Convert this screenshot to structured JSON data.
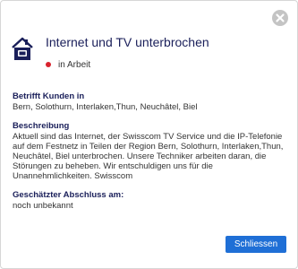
{
  "dialog": {
    "title": "Internet und TV unterbrochen",
    "status": {
      "text": "in Arbeit",
      "color": "#d9232e"
    },
    "icons": {
      "header": "house-icon",
      "close": "close-icon"
    },
    "sections": {
      "affected": {
        "heading": "Betrifft Kunden in",
        "body": "Bern, Solothurn, Interlaken,Thun, Neuchâtel, Biel"
      },
      "description": {
        "heading": "Beschreibung",
        "lines": [
          "Aktuell sind das Internet, der Swisscom TV Service und die IP-Telefonie",
          "auf dem Festnetz in Teilen der Region Bern, Solothurn, Interlaken,Thun,",
          "Neuchâtel, Biel unterbrochen. Unsere Techniker arbeiten daran, die",
          "Störungen zu beheben. Wir entschuldigen uns für die",
          "Unannehmlichkeiten. Swisscom"
        ]
      },
      "eta": {
        "heading": "Geschätzter Abschluss am:",
        "body": "noch unbekannt"
      }
    },
    "close_button_label": "Schliessen",
    "colors": {
      "heading": "#1a1f5a",
      "button": "#1f6fd6"
    }
  }
}
